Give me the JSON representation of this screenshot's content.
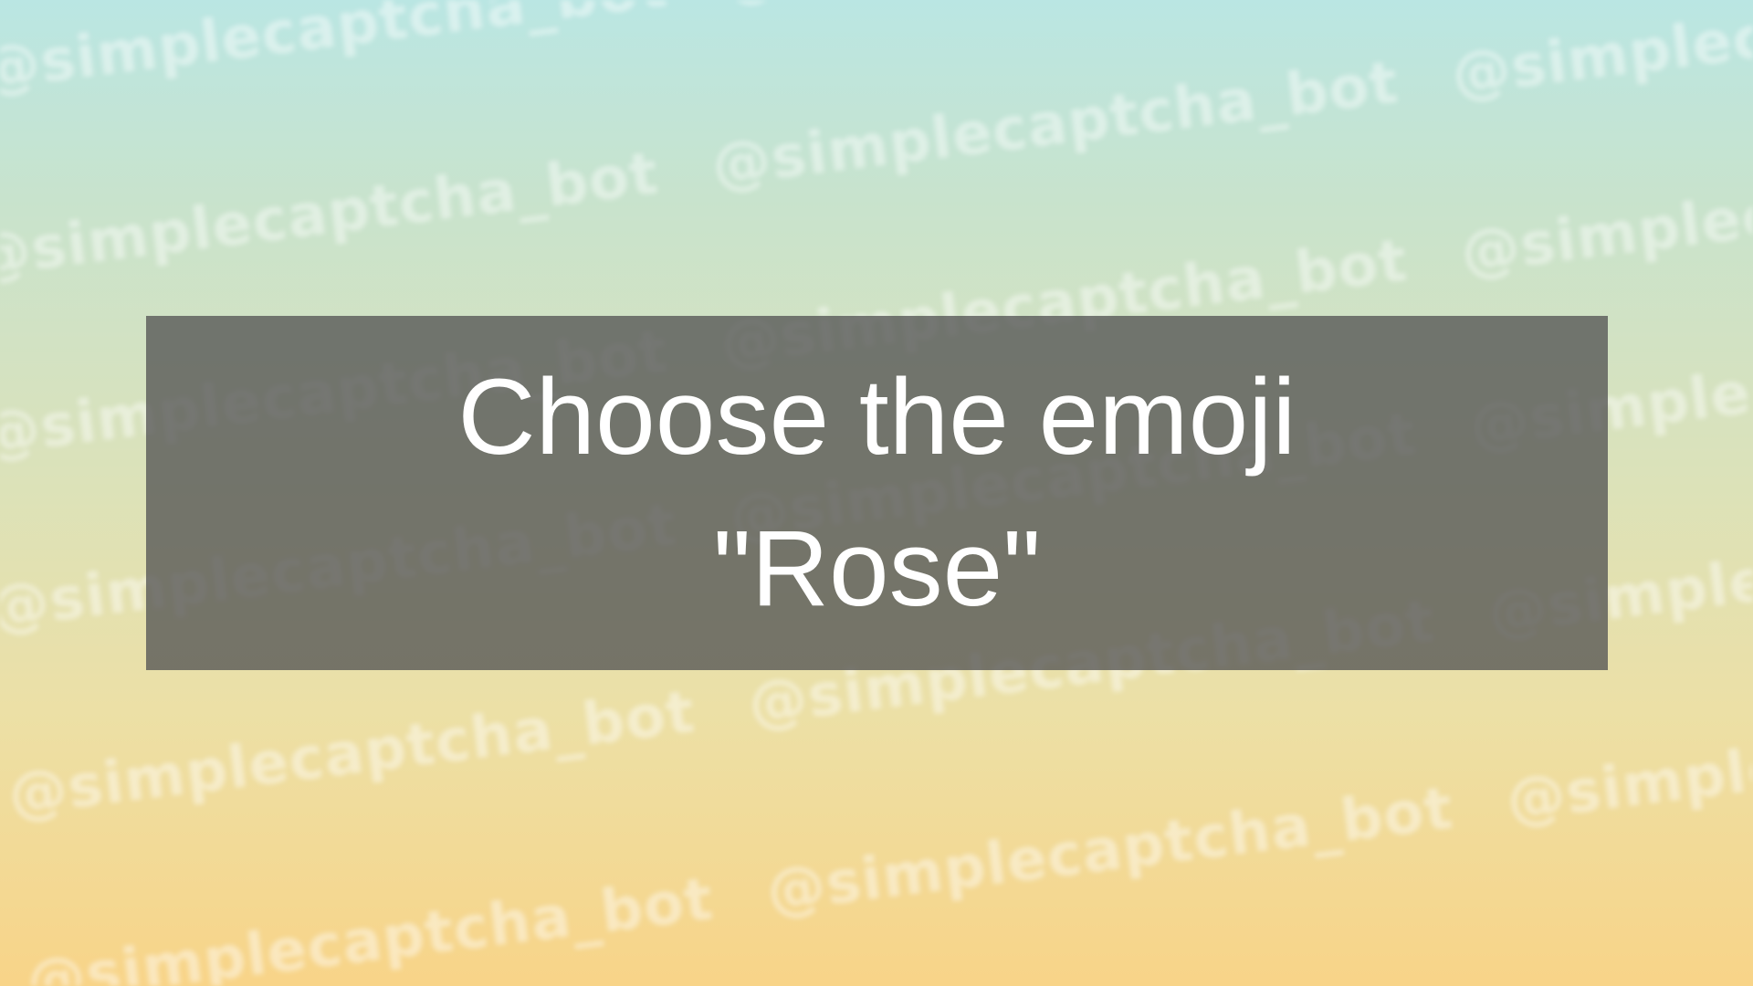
{
  "background": {
    "watermark_text": "@simplecaptcha_bot",
    "gradient_top_color": "#bae6e3",
    "gradient_bottom_color": "#f8d488"
  },
  "captcha": {
    "instruction": "Choose the emoji",
    "emoji_name": "\"Rose\"",
    "box_color": "#555555",
    "text_color": "#ffffff"
  }
}
